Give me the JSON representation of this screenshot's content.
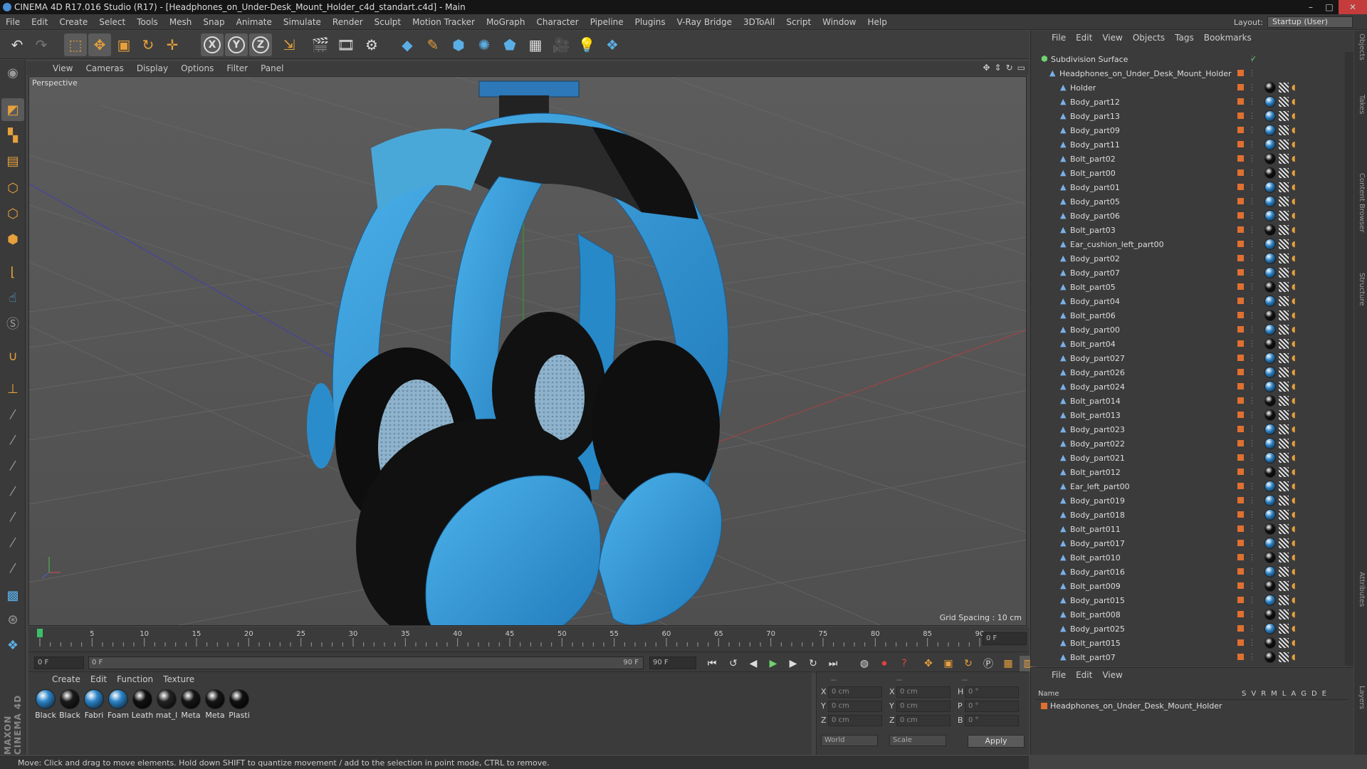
{
  "app": {
    "title": "CINEMA 4D R17.016 Studio (R17) - [Headphones_on_Under-Desk_Mount_Holder_c4d_standart.c4d] - Main"
  },
  "window": {
    "minimize": "–",
    "maximize": "□",
    "close": "✕"
  },
  "menubar": [
    "File",
    "Edit",
    "Create",
    "Select",
    "Tools",
    "Mesh",
    "Snap",
    "Animate",
    "Simulate",
    "Render",
    "Sculpt",
    "Motion Tracker",
    "MoGraph",
    "Character",
    "Pipeline",
    "Plugins",
    "V-Ray Bridge",
    "3DToAll",
    "Script",
    "Window",
    "Help"
  ],
  "layout": {
    "label": "Layout:",
    "value": "Startup (User)"
  },
  "viewport": {
    "menu": [
      "View",
      "Cameras",
      "Display",
      "Options",
      "Filter",
      "Panel"
    ],
    "label": "Perspective",
    "grid_spacing": "Grid Spacing : 10 cm",
    "axis_x": "x",
    "axis_y": "y",
    "axis_z": "z"
  },
  "timeline": {
    "ticks": [
      "0",
      "5",
      "10",
      "15",
      "20",
      "25",
      "30",
      "35",
      "40",
      "45",
      "50",
      "55",
      "60",
      "65",
      "70",
      "75",
      "80",
      "85",
      "90"
    ],
    "end_field": "0 F",
    "current_frame": "0 F",
    "range_start": "0 F",
    "range_end": "90 F",
    "max_frame": "90 F"
  },
  "materials": {
    "menu": [
      "Create",
      "Edit",
      "Function",
      "Texture"
    ],
    "items": [
      {
        "name": "Black",
        "color": "#2d84c8"
      },
      {
        "name": "Black",
        "color": "#1a1a1a"
      },
      {
        "name": "Fabri",
        "color": "#2d84c8"
      },
      {
        "name": "Foam",
        "color": "#2d84c8"
      },
      {
        "name": "Leath",
        "color": "#111111"
      },
      {
        "name": "mat_l",
        "color": "#222222"
      },
      {
        "name": "Meta",
        "color": "#151515"
      },
      {
        "name": "Meta",
        "color": "#151515"
      },
      {
        "name": "Plasti",
        "color": "#101010"
      }
    ]
  },
  "coords": {
    "header": [
      "--",
      "--",
      "--"
    ],
    "rows": [
      {
        "a": "X",
        "av": "0 cm",
        "b": "X",
        "bv": "0 cm",
        "c": "H",
        "cv": "0 °"
      },
      {
        "a": "Y",
        "av": "0 cm",
        "b": "Y",
        "bv": "0 cm",
        "c": "P",
        "cv": "0 °"
      },
      {
        "a": "Z",
        "av": "0 cm",
        "b": "Z",
        "bv": "0 cm",
        "c": "B",
        "cv": "0 °"
      }
    ],
    "world": "World",
    "scale": "Scale",
    "apply": "Apply"
  },
  "status": "Move: Click and drag to move elements. Hold down SHIFT to quantize movement / add to the selection in point mode, CTRL to remove.",
  "logo": "MAXON CINEMA 4D",
  "objects": {
    "menu": [
      "File",
      "Edit",
      "View",
      "Objects",
      "Tags",
      "Bookmarks"
    ],
    "root": "Subdivision Surface",
    "group": "Headphones_on_Under_Desk_Mount_Holder",
    "items": [
      {
        "n": "Holder",
        "m": "#111111"
      },
      {
        "n": "Body_part12",
        "m": "#2d84c8"
      },
      {
        "n": "Body_part13",
        "m": "#2d84c8"
      },
      {
        "n": "Body_part09",
        "m": "#2d84c8"
      },
      {
        "n": "Body_part11",
        "m": "#2d84c8"
      },
      {
        "n": "Bolt_part02",
        "m": "#111111"
      },
      {
        "n": "Bolt_part00",
        "m": "#111111"
      },
      {
        "n": "Body_part01",
        "m": "#2d84c8"
      },
      {
        "n": "Body_part05",
        "m": "#2d84c8"
      },
      {
        "n": "Body_part06",
        "m": "#2d84c8"
      },
      {
        "n": "Bolt_part03",
        "m": "#111111"
      },
      {
        "n": "Ear_cushion_left_part00",
        "m": "#2d84c8"
      },
      {
        "n": "Body_part02",
        "m": "#2d84c8"
      },
      {
        "n": "Body_part07",
        "m": "#2d84c8"
      },
      {
        "n": "Bolt_part05",
        "m": "#111111"
      },
      {
        "n": "Body_part04",
        "m": "#2d84c8"
      },
      {
        "n": "Bolt_part06",
        "m": "#111111"
      },
      {
        "n": "Body_part00",
        "m": "#2d84c8"
      },
      {
        "n": "Bolt_part04",
        "m": "#111111"
      },
      {
        "n": "Body_part027",
        "m": "#2d84c8"
      },
      {
        "n": "Body_part026",
        "m": "#2d84c8"
      },
      {
        "n": "Body_part024",
        "m": "#2d84c8"
      },
      {
        "n": "Bolt_part014",
        "m": "#111111"
      },
      {
        "n": "Bolt_part013",
        "m": "#111111"
      },
      {
        "n": "Body_part023",
        "m": "#2d84c8"
      },
      {
        "n": "Body_part022",
        "m": "#2d84c8"
      },
      {
        "n": "Body_part021",
        "m": "#2d84c8"
      },
      {
        "n": "Bolt_part012",
        "m": "#111111"
      },
      {
        "n": "Ear_left_part00",
        "m": "#2d84c8"
      },
      {
        "n": "Body_part019",
        "m": "#2d84c8"
      },
      {
        "n": "Body_part018",
        "m": "#2d84c8"
      },
      {
        "n": "Bolt_part011",
        "m": "#111111"
      },
      {
        "n": "Body_part017",
        "m": "#2d84c8"
      },
      {
        "n": "Bolt_part010",
        "m": "#111111"
      },
      {
        "n": "Body_part016",
        "m": "#2d84c8"
      },
      {
        "n": "Bolt_part009",
        "m": "#111111"
      },
      {
        "n": "Body_part015",
        "m": "#2d84c8"
      },
      {
        "n": "Bolt_part008",
        "m": "#111111"
      },
      {
        "n": "Body_part025",
        "m": "#2d84c8"
      },
      {
        "n": "Bolt_part015",
        "m": "#111111"
      },
      {
        "n": "Bolt_part07",
        "m": "#111111"
      }
    ]
  },
  "layers": {
    "menu": [
      "File",
      "Edit",
      "View"
    ],
    "col_name": "Name",
    "cols": [
      "S",
      "V",
      "R",
      "M",
      "L",
      "A",
      "G",
      "D",
      "E"
    ],
    "item": "Headphones_on_Under_Desk_Mount_Holder"
  },
  "sidetabs": [
    "Objects",
    "Takes",
    "Content Browser",
    "Structure",
    "Attributes",
    "Layers"
  ],
  "colors": {
    "accent": "#e6a03c",
    "headphone_blue": "#2d8fd0",
    "viewport_bg": "#575757"
  }
}
